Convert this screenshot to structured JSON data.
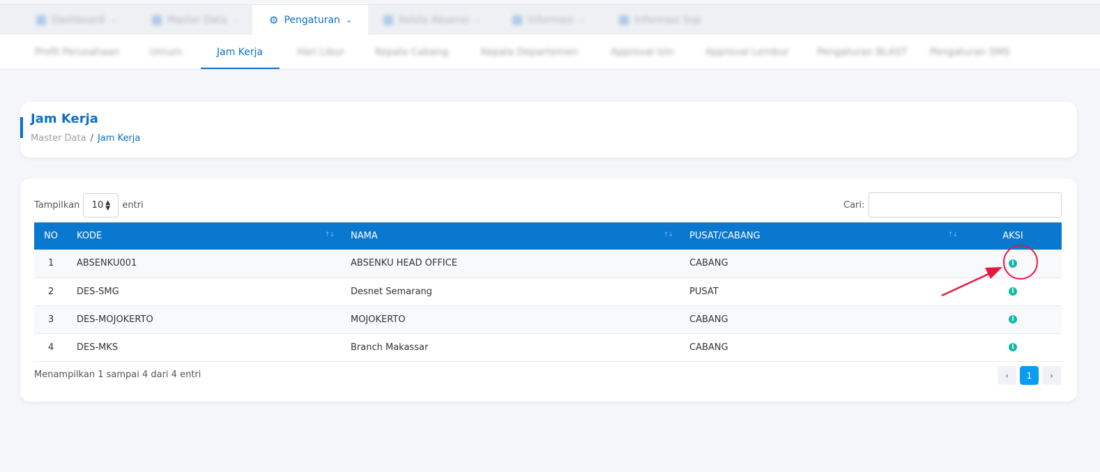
{
  "main_nav": {
    "items": [
      {
        "label": "Dashboard",
        "blurred": true
      },
      {
        "label": "Master Data",
        "blurred": true
      },
      {
        "label": "Pengaturan",
        "blurred": false,
        "active": true
      },
      {
        "label": "Kelola Absensi",
        "blurred": true
      },
      {
        "label": "Informasi",
        "blurred": true
      },
      {
        "label": "Informasi Sop",
        "blurred": true
      }
    ]
  },
  "sub_nav": {
    "tabs": [
      {
        "label": "Profil Perusahaan"
      },
      {
        "label": "Umum"
      },
      {
        "label": "Jam Kerja",
        "active": true
      },
      {
        "label": "Hari Libur"
      },
      {
        "label": "Kepala Cabang"
      },
      {
        "label": "Kepala Departemen"
      },
      {
        "label": "Approval Izin"
      },
      {
        "label": "Approval Lembur"
      },
      {
        "label": "Pengaturan BLAST"
      },
      {
        "label": "Pengaturan SMS"
      }
    ]
  },
  "header": {
    "title": "Jam Kerja",
    "breadcrumb": [
      "Master Data",
      "/",
      "Jam Kerja"
    ]
  },
  "table_controls": {
    "show_label": "Tampilkan",
    "page_size": "10",
    "entries_label": "entri",
    "search_label": "Cari:",
    "search_value": ""
  },
  "table": {
    "columns": [
      "NO",
      "KODE",
      "NAMA",
      "PUSAT/CABANG",
      "AKSI"
    ],
    "rows": [
      {
        "no": "1",
        "kode": "ABSENKU001",
        "nama": "ABSENKU HEAD OFFICE",
        "tipe": "CABANG"
      },
      {
        "no": "2",
        "kode": "DES-SMG",
        "nama": "Desnet Semarang",
        "tipe": "PUSAT"
      },
      {
        "no": "3",
        "kode": "DES-MOJOKERTO",
        "nama": "MOJOKERTO",
        "tipe": "CABANG"
      },
      {
        "no": "4",
        "kode": "DES-MKS",
        "nama": "Branch Makassar",
        "tipe": "CABANG"
      }
    ],
    "action_icon": "info-icon"
  },
  "footer": {
    "info": "Menampilkan 1 sampai 4 dari 4 entri",
    "prev": "‹",
    "page": "1",
    "next": "›"
  },
  "colors": {
    "primary": "#0b6fc6",
    "header_bg": "#0b78d0",
    "info_icon": "#14b8a6",
    "annotation": "#e8173f"
  }
}
